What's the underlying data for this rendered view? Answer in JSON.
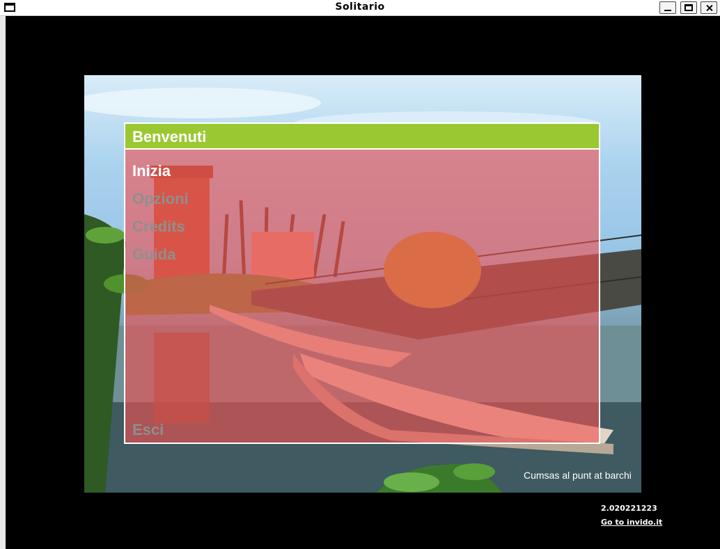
{
  "window": {
    "title": "Solitario"
  },
  "menu": {
    "header": "Benvenuti",
    "items": [
      {
        "label": "Inizia",
        "active": true
      },
      {
        "label": "Opzioni",
        "active": false
      },
      {
        "label": "Credits",
        "active": false
      },
      {
        "label": "Guida",
        "active": false
      }
    ],
    "exit": "Esci"
  },
  "caption": "Cumsas al punt at barchi",
  "version": "2.020221223",
  "link": "Go to invido.it",
  "colors": {
    "header": "#9ac832",
    "overlay": "#f05050",
    "inactive": "#8f8f8f"
  }
}
